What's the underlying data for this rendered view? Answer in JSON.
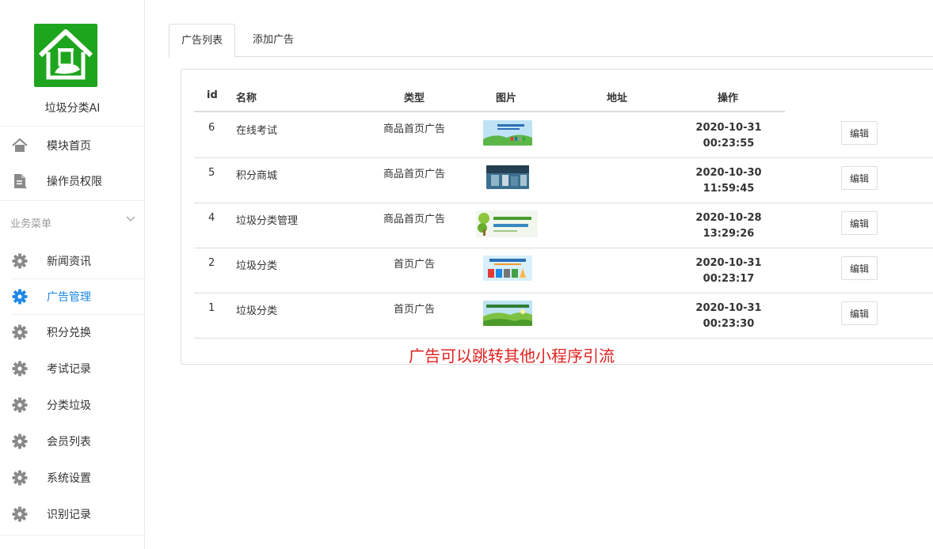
{
  "app": {
    "name": "垃圾分类AI"
  },
  "sidebar": {
    "top_items": [
      {
        "label": "模块首页",
        "icon": "home-icon"
      },
      {
        "label": "操作员权限",
        "icon": "document-icon"
      }
    ],
    "section_title": "业务菜单",
    "menu_items": [
      {
        "label": "新闻资讯",
        "icon": "gear-icon"
      },
      {
        "label": "广告管理",
        "icon": "gear-icon",
        "active": true
      },
      {
        "label": "积分兑换",
        "icon": "gear-icon"
      },
      {
        "label": "考试记录",
        "icon": "gear-icon"
      },
      {
        "label": "分类垃圾",
        "icon": "gear-icon"
      },
      {
        "label": "会员列表",
        "icon": "gear-icon"
      },
      {
        "label": "系统设置",
        "icon": "gear-icon"
      },
      {
        "label": "识别记录",
        "icon": "gear-icon"
      }
    ]
  },
  "colors": {
    "brand": "#1ea51e",
    "accent": "#1e88e5",
    "note": "#e02020"
  },
  "tabs": [
    {
      "label": "广告列表",
      "active": true
    },
    {
      "label": "添加广告"
    }
  ],
  "table": {
    "headers": {
      "id": "id",
      "name": "名称",
      "type": "类型",
      "image": "图片",
      "url": "地址",
      "action": "操作"
    },
    "rows": [
      {
        "id": "6",
        "name": "在线考试",
        "type": "商品首页广告",
        "date": "2020-10-31",
        "time": "00:23:55",
        "edit": "编辑"
      },
      {
        "id": "5",
        "name": "积分商城",
        "type": "商品首页广告",
        "date": "2020-10-30",
        "time": "11:59:45",
        "edit": "编辑"
      },
      {
        "id": "4",
        "name": "垃圾分类管理",
        "type": "商品首页广告",
        "date": "2020-10-28",
        "time": "13:29:26",
        "edit": "编辑"
      },
      {
        "id": "2",
        "name": "垃圾分类",
        "type": "首页广告",
        "date": "2020-10-31",
        "time": "00:23:17",
        "edit": "编辑"
      },
      {
        "id": "1",
        "name": "垃圾分类",
        "type": "首页广告",
        "date": "2020-10-31",
        "time": "00:23:30",
        "edit": "编辑"
      }
    ]
  },
  "note": "广告可以跳转其他小程序引流"
}
